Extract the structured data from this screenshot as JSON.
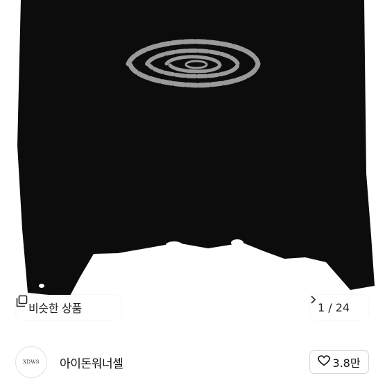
{
  "similar_products": {
    "icon": "similar-items-icon",
    "label": "비슷한 상품"
  },
  "pager": {
    "current": 1,
    "total": 24,
    "text": "1 / 24",
    "next_icon": "chevron-right-icon"
  },
  "seller": {
    "avatar_text": "XDWS",
    "name": "아이돈워너셀"
  },
  "like": {
    "icon": "heart-outline-icon",
    "count": "3.8만"
  },
  "colors": {
    "sweater": "#0c0c0c",
    "pattern": "#9a9a9a",
    "chip_bg": "#ffffff"
  }
}
